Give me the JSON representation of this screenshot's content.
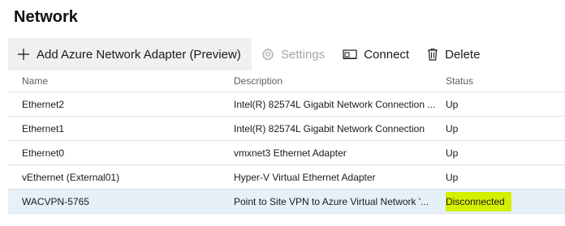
{
  "page": {
    "title": "Network"
  },
  "toolbar": {
    "add_label": "Add Azure Network Adapter (Preview)",
    "add_icon": "plus-icon",
    "settings_label": "Settings",
    "settings_icon": "gear-icon",
    "connect_label": "Connect",
    "connect_icon": "connect-icon",
    "delete_label": "Delete",
    "delete_icon": "trash-icon"
  },
  "table": {
    "columns": [
      "Name",
      "Description",
      "Status"
    ],
    "rows": [
      {
        "name": "Ethernet2",
        "description": "Intel(R) 82574L Gigabit Network Connection ...",
        "status": "Up"
      },
      {
        "name": "Ethernet1",
        "description": "Intel(R) 82574L Gigabit Network Connection",
        "status": "Up"
      },
      {
        "name": "Ethernet0",
        "description": "vmxnet3 Ethernet Adapter",
        "status": "Up"
      },
      {
        "name": "vEthernet (External01)",
        "description": "Hyper-V Virtual Ethernet Adapter",
        "status": "Up"
      },
      {
        "name": "WACVPN-5765",
        "description": "Point to Site VPN to Azure Virtual Network '...",
        "status": "Disconnected"
      }
    ]
  },
  "colors": {
    "selected_row": "#e6f0f9",
    "status_highlight": "#d4ef00",
    "toolbar_highlight": "#f0f0f0"
  }
}
